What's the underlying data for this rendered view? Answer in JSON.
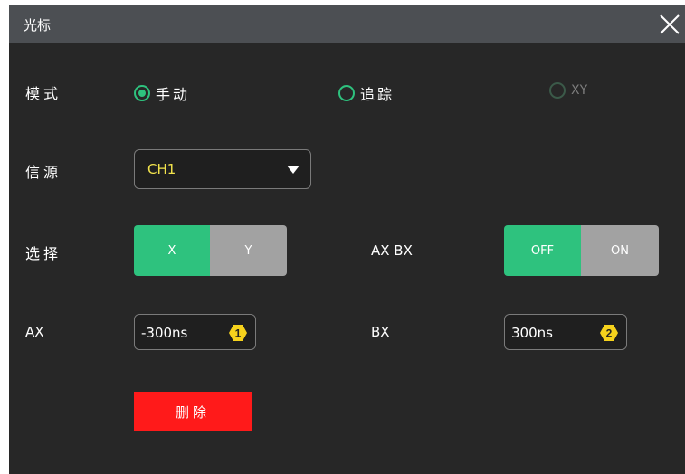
{
  "dialog": {
    "title": "光标"
  },
  "mode": {
    "label": "模式",
    "options": [
      {
        "label": "手动",
        "selected": true,
        "enabled": true
      },
      {
        "label": "追踪",
        "selected": false,
        "enabled": true
      },
      {
        "label": "XY",
        "selected": false,
        "enabled": false
      }
    ]
  },
  "source": {
    "label": "信源",
    "value": "CH1"
  },
  "select": {
    "label": "选择",
    "options": [
      "X",
      "Y"
    ],
    "selected": "X"
  },
  "axbx": {
    "label": "AX BX",
    "options": [
      "OFF",
      "ON"
    ],
    "selected": "OFF"
  },
  "ax": {
    "label": "AX",
    "value": "-300ns",
    "badge": "1"
  },
  "bx": {
    "label": "BX",
    "value": "300ns",
    "badge": "2"
  },
  "delete_label": "删除",
  "colors": {
    "accent": "#2ec27e",
    "danger": "#ff1a1a",
    "source_text": "#f2e34c",
    "badge": "#f6d21c"
  }
}
